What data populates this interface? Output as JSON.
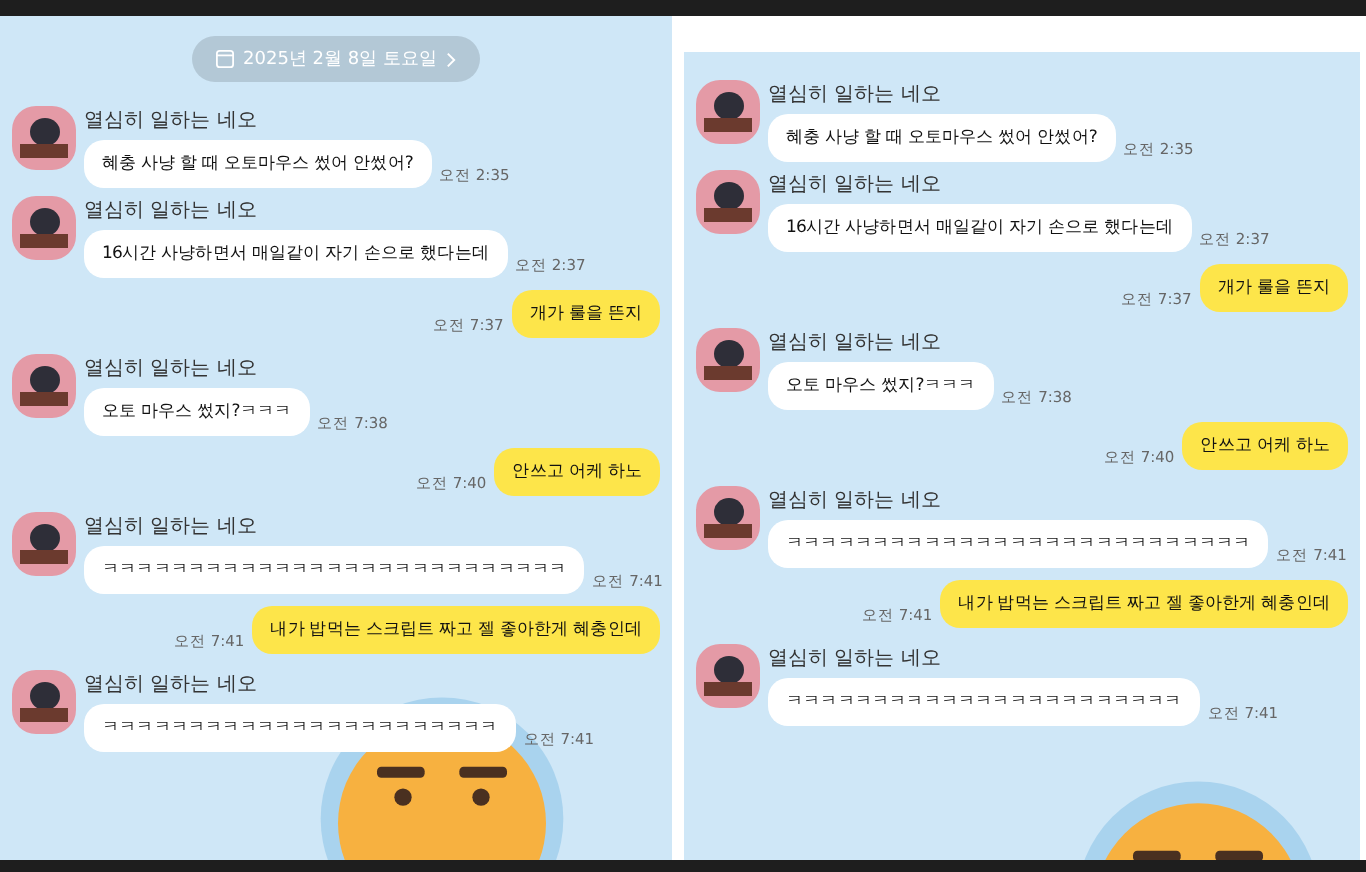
{
  "panels": [
    {
      "date_label": "2025년 2월 8일 토요일",
      "messages": [
        {
          "kind": "received",
          "sender": "열심히 일하는 네오",
          "text": "혜충 사냥 할 때 오토마우스 썼어 안썼어?",
          "time": "오전 2:35"
        },
        {
          "kind": "received",
          "sender": "열심히 일하는 네오",
          "text": "16시간 사냥하면서 매일같이 자기 손으로 했다는데",
          "time": "오전 2:37"
        },
        {
          "kind": "sent",
          "text": "개가 룰을 뜬지",
          "time": "오전 7:37"
        },
        {
          "kind": "received",
          "sender": "열심히 일하는 네오",
          "text": "오토 마우스 썼지?ㅋㅋㅋ",
          "time": "오전 7:38"
        },
        {
          "kind": "sent",
          "text": "안쓰고 어케 하노",
          "time": "오전 7:40"
        },
        {
          "kind": "received",
          "sender": "열심히 일하는 네오",
          "text": "ㅋㅋㅋㅋㅋㅋㅋㅋㅋㅋㅋㅋㅋㅋㅋㅋㅋㅋㅋㅋㅋㅋㅋㅋㅋㅋㅋ",
          "time": "오전 7:41"
        },
        {
          "kind": "sent",
          "text": "내가 밥먹는 스크립트 짜고 젤 좋아한게 혜충인데",
          "time": "오전 7:41"
        },
        {
          "kind": "received",
          "sender": "열심히 일하는 네오",
          "text": "ㅋㅋㅋㅋㅋㅋㅋㅋㅋㅋㅋㅋㅋㅋㅋㅋㅋㅋㅋㅋㅋㅋㅋ",
          "time": "오전 7:41"
        }
      ]
    },
    {
      "messages": [
        {
          "kind": "received",
          "sender": "열심히 일하는 네오",
          "text": "혜충 사냥 할 때 오토마우스 썼어 안썼어?",
          "time": "오전 2:35"
        },
        {
          "kind": "received",
          "sender": "열심히 일하는 네오",
          "text": "16시간 사냥하면서 매일같이 자기 손으로 했다는데",
          "time": "오전 2:37"
        },
        {
          "kind": "sent",
          "text": "개가 룰을 뜬지",
          "time": "오전 7:37"
        },
        {
          "kind": "received",
          "sender": "열심히 일하는 네오",
          "text": "오토 마우스 썼지?ㅋㅋㅋ",
          "time": "오전 7:38"
        },
        {
          "kind": "sent",
          "text": "안쓰고 어케 하노",
          "time": "오전 7:40"
        },
        {
          "kind": "received",
          "sender": "열심히 일하는 네오",
          "text": "ㅋㅋㅋㅋㅋㅋㅋㅋㅋㅋㅋㅋㅋㅋㅋㅋㅋㅋㅋㅋㅋㅋㅋㅋㅋㅋㅋ",
          "time": "오전 7:41"
        },
        {
          "kind": "sent",
          "text": "내가 밥먹는 스크립트 짜고 젤 좋아한게 혜충인데",
          "time": "오전 7:41"
        },
        {
          "kind": "received",
          "sender": "열심히 일하는 네오",
          "text": "ㅋㅋㅋㅋㅋㅋㅋㅋㅋㅋㅋㅋㅋㅋㅋㅋㅋㅋㅋㅋㅋㅋㅋ",
          "time": "오전 7:41"
        }
      ]
    }
  ]
}
